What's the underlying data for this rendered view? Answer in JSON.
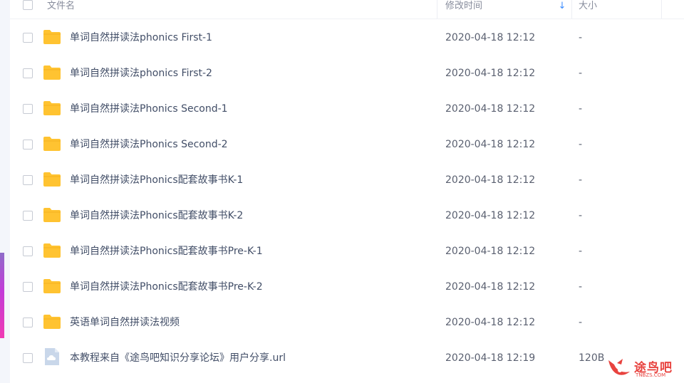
{
  "header": {
    "name_label": "文件名",
    "mtime_label": "修改时间",
    "size_label": "大小"
  },
  "rows": [
    {
      "name": "单词自然拼读法phonics First-1",
      "mtime": "2020-04-18 12:12",
      "size": "-",
      "type": "folder"
    },
    {
      "name": "单词自然拼读法phonics First-2",
      "mtime": "2020-04-18 12:12",
      "size": "-",
      "type": "folder"
    },
    {
      "name": "单词自然拼读法Phonics Second-1",
      "mtime": "2020-04-18 12:12",
      "size": "-",
      "type": "folder"
    },
    {
      "name": "单词自然拼读法Phonics Second-2",
      "mtime": "2020-04-18 12:12",
      "size": "-",
      "type": "folder"
    },
    {
      "name": "单词自然拼读法Phonics配套故事书K-1",
      "mtime": "2020-04-18 12:12",
      "size": "-",
      "type": "folder"
    },
    {
      "name": "单词自然拼读法Phonics配套故事书K-2",
      "mtime": "2020-04-18 12:12",
      "size": "-",
      "type": "folder"
    },
    {
      "name": "单词自然拼读法Phonics配套故事书Pre-K-1",
      "mtime": "2020-04-18 12:12",
      "size": "-",
      "type": "folder"
    },
    {
      "name": "单词自然拼读法Phonics配套故事书Pre-K-2",
      "mtime": "2020-04-18 12:12",
      "size": "-",
      "type": "folder"
    },
    {
      "name": "英语单词自然拼读法视频",
      "mtime": "2020-04-18 12:12",
      "size": "-",
      "type": "folder"
    },
    {
      "name": "本教程来自《途鸟吧知识分享论坛》用户分享.url",
      "mtime": "2020-04-18 12:19",
      "size": "120B",
      "type": "url-file"
    }
  ],
  "watermark": {
    "text": "途鸟吧",
    "sub": "TNBZS.COM"
  },
  "colors": {
    "folder": "#ffc331",
    "accent": "#3b8cff",
    "watermark": "#e8433f"
  },
  "icons": {
    "sort": "arrow-down-icon",
    "folder": "folder-icon",
    "url_file": "cloud-file-icon"
  }
}
